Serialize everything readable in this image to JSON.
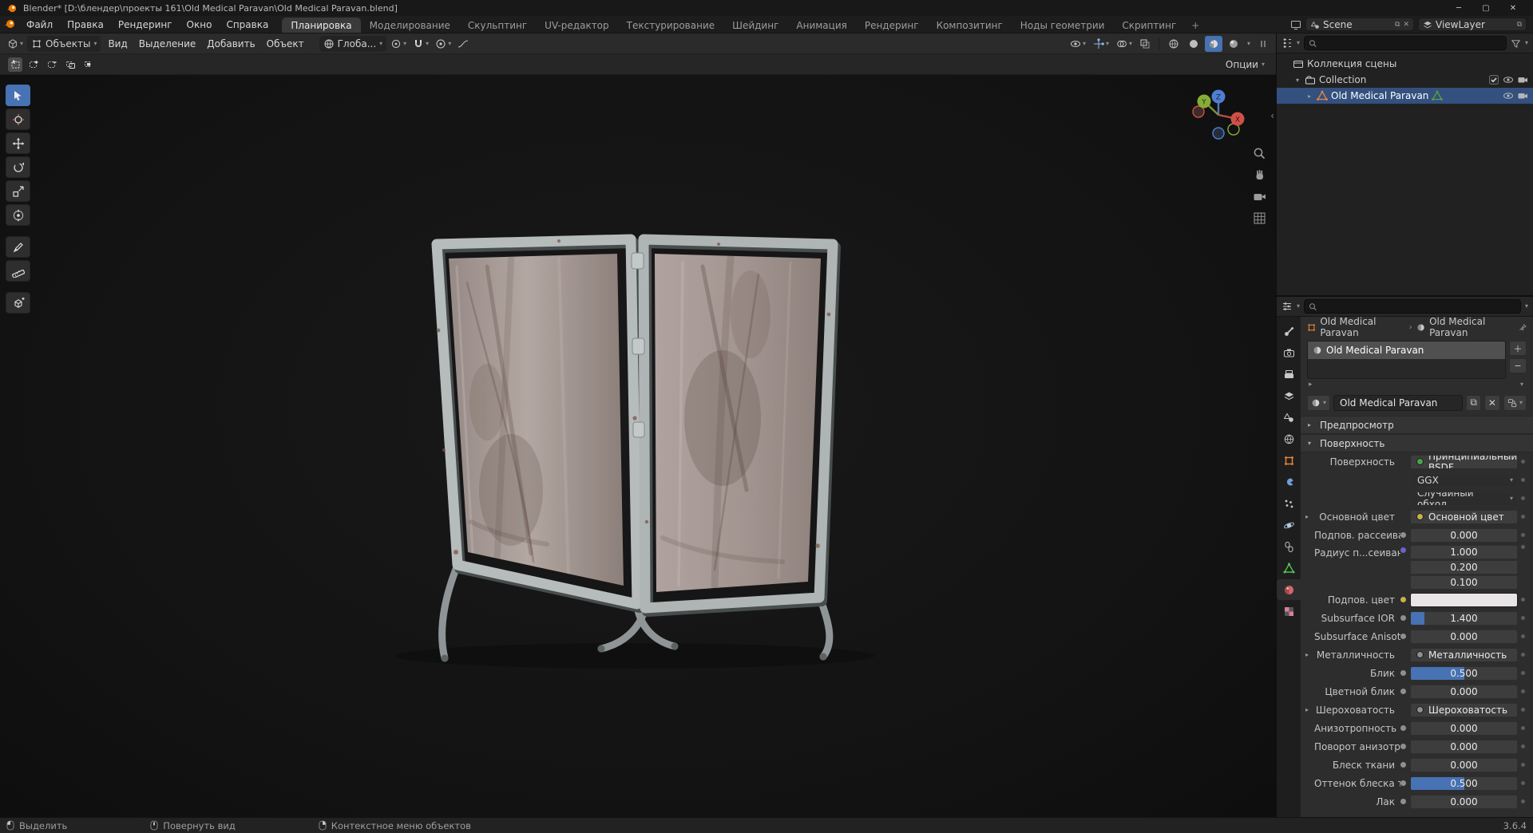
{
  "window": {
    "title": "Blender* [D:\\блендер\\проекты 161\\Old Medical Paravan\\Old Medical Paravan.blend]"
  },
  "topbar": {
    "menus": [
      "Файл",
      "Правка",
      "Рендеринг",
      "Окно",
      "Справка"
    ],
    "tabs": [
      "Планировка",
      "Моделирование",
      "Скульптинг",
      "UV-редактор",
      "Текстурирование",
      "Шейдинг",
      "Анимация",
      "Рендеринг",
      "Композитинг",
      "Ноды геометрии",
      "Скриптинг"
    ],
    "active_tab": "Планировка",
    "add_tab_label": "+",
    "scene": {
      "label": "Scene"
    },
    "viewlayer": {
      "label": "ViewLayer"
    }
  },
  "viewport": {
    "header": {
      "mode_label": "Объекты",
      "menus": [
        "Вид",
        "Выделение",
        "Добавить",
        "Объект"
      ],
      "orientation_label": "Глоба...",
      "options_label": "Опции"
    },
    "tools": [
      {
        "name": "select-box",
        "active": true
      },
      {
        "name": "cursor",
        "active": false
      },
      {
        "name": "move",
        "active": false
      },
      {
        "name": "rotate",
        "active": false
      },
      {
        "name": "scale",
        "active": false
      },
      {
        "name": "transform",
        "active": false
      },
      {
        "name": "annotate",
        "active": false
      },
      {
        "name": "measure",
        "active": false
      },
      {
        "name": "add-cube",
        "active": false
      }
    ],
    "gizmo_axes": [
      "X",
      "Y",
      "Z"
    ]
  },
  "outliner": {
    "rows": [
      {
        "label": "Коллекция сцены",
        "indent": 0,
        "icon": "scene-collection",
        "arrow": "",
        "right": [],
        "selected": false
      },
      {
        "label": "Collection",
        "indent": 1,
        "icon": "collection",
        "arrow": "▾",
        "right": [
          "checkbox",
          "eye",
          "camera"
        ],
        "selected": false
      },
      {
        "label": "Old Medical Paravan",
        "indent": 2,
        "icon": "mesh-object",
        "data_icon": "mesh-data",
        "arrow": "▸",
        "right": [
          "eye",
          "camera"
        ],
        "selected": true
      }
    ]
  },
  "properties": {
    "breadcrumb": {
      "object": "Old Medical Paravan",
      "material": "Old Medical Paravan"
    },
    "slot_name": "Old Medical Paravan",
    "material_name": "Old Medical Paravan",
    "sections": {
      "preview": "Предпросмотр",
      "surface": "Поверхность"
    },
    "tabs": [
      {
        "name": "tool",
        "active": false
      },
      {
        "name": "render",
        "active": false
      },
      {
        "name": "output",
        "active": false
      },
      {
        "name": "view-layer",
        "active": false
      },
      {
        "name": "scene",
        "active": false
      },
      {
        "name": "world",
        "active": false
      },
      {
        "name": "object",
        "active": false
      },
      {
        "name": "modifiers",
        "active": false
      },
      {
        "name": "particles",
        "active": false
      },
      {
        "name": "physics",
        "active": false
      },
      {
        "name": "constraints",
        "active": false
      },
      {
        "name": "data",
        "active": false
      },
      {
        "name": "material",
        "active": true
      },
      {
        "name": "texture",
        "active": false
      }
    ],
    "surface_rows": [
      {
        "label": "Поверхность",
        "type": "node",
        "value": "Принципиальный BSDF",
        "socket": "bsdf_node"
      },
      {
        "label": "",
        "type": "dropdown",
        "value": "GGX"
      },
      {
        "label": "",
        "type": "dropdown",
        "value": "Случайный обход"
      },
      {
        "label": "Основной цвет",
        "type": "link",
        "value": "Основной цвет",
        "socket": "socket_color",
        "expander": true
      },
      {
        "label": "Подпов. рассеива...",
        "type": "number",
        "value": "0.000",
        "socket": "socket_float"
      },
      {
        "label": "Радиус п...сеивания",
        "type": "stack",
        "values": [
          "1.000",
          "0.200",
          "0.100"
        ],
        "socket": "socket_vector"
      },
      {
        "label": "Подпов. цвет",
        "type": "color",
        "value": "#e9e4e6",
        "socket": "socket_color"
      },
      {
        "label": "Subsurface IOR",
        "type": "slider",
        "value": "1.400",
        "fill": 0.13,
        "socket": "socket_float"
      },
      {
        "label": "Subsurface Anisotr...",
        "type": "number",
        "value": "0.000",
        "socket": "socket_float"
      },
      {
        "label": "Металличность",
        "type": "link",
        "value": "Металличность",
        "socket": "socket_float",
        "expander": true
      },
      {
        "label": "Блик",
        "type": "slider",
        "value": "0.500",
        "fill": 0.5,
        "socket": "socket_float"
      },
      {
        "label": "Цветной блик",
        "type": "number",
        "value": "0.000",
        "socket": "socket_float"
      },
      {
        "label": "Шероховатость",
        "type": "link",
        "value": "Шероховатость",
        "socket": "socket_float",
        "expander": true
      },
      {
        "label": "Анизотропность",
        "type": "number",
        "value": "0.000",
        "socket": "socket_float"
      },
      {
        "label": "Поворот анизотро...",
        "type": "number",
        "value": "0.000",
        "socket": "socket_float"
      },
      {
        "label": "Блеск ткани",
        "type": "number",
        "value": "0.000",
        "socket": "socket_float"
      },
      {
        "label": "Оттенок блеска тк...",
        "type": "slider",
        "value": "0.500",
        "fill": 0.5,
        "socket": "socket_float"
      },
      {
        "label": "Лак",
        "type": "number",
        "value": "0.000",
        "socket": "socket_float"
      }
    ]
  },
  "statusbar": {
    "items": [
      {
        "label": "Выделить",
        "mouse": "lmb"
      },
      {
        "label": "Повернуть вид",
        "mouse": "mmb"
      },
      {
        "label": "Контекстное меню объектов",
        "mouse": "rmb"
      }
    ],
    "version": "3.6.4"
  },
  "colors": {
    "accent": "#4772b3",
    "selection": "#33507e",
    "object": "#e8863a",
    "mesh_data": "#56a33c",
    "socket_float": "#8f8f8f",
    "socket_color": "#c8b14a",
    "socket_vector": "#6a63c9",
    "bsdf_node": "#4aa34a"
  }
}
